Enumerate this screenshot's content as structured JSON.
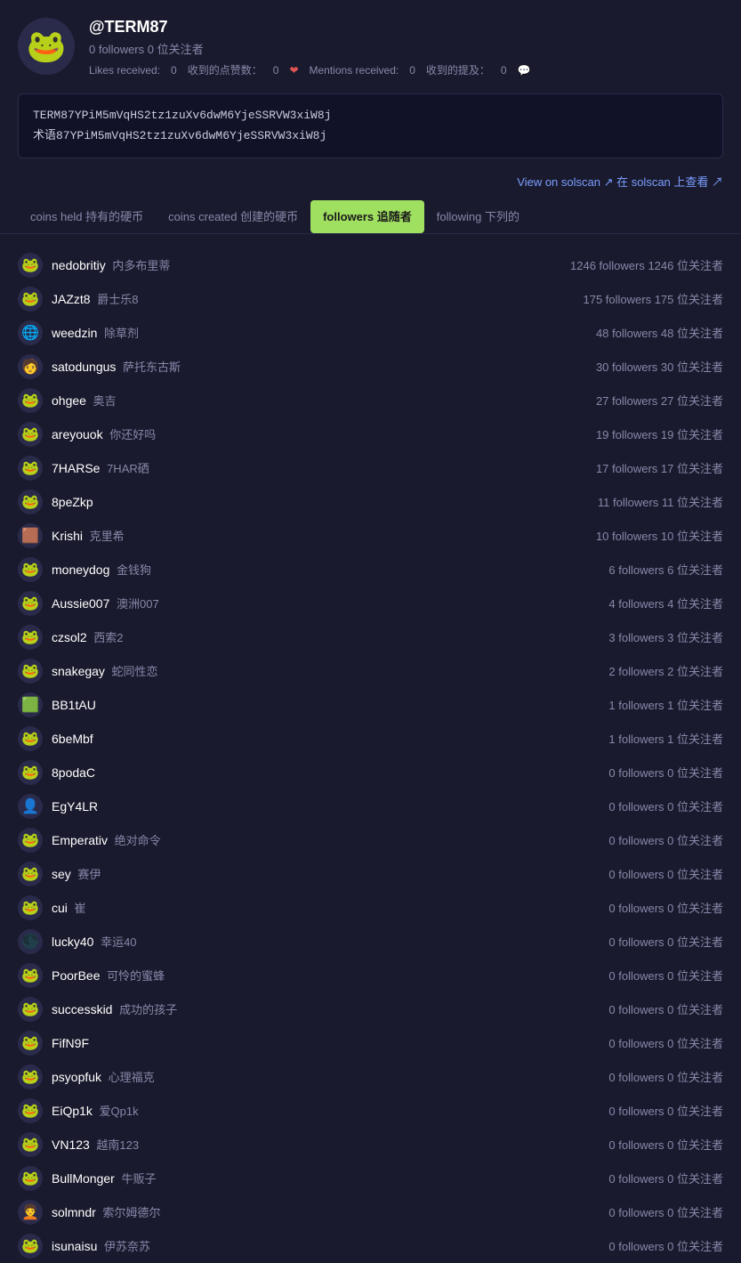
{
  "profile": {
    "username": "@TERM87",
    "stats": "0 followers 0 位关注者",
    "likes_label": "Likes received:",
    "likes_value": "0",
    "likes_chinese": "收到的点赞数：",
    "likes_count": "0",
    "heart": "❤",
    "mentions_label": "Mentions received:",
    "mentions_value": "0",
    "mentions_chinese": "收到的提及：",
    "mentions_count": "0",
    "wallet1": "TERM87YPiM5mVqHS2tz1zuXv6dwM6YjeSSRVW3xiW8j",
    "wallet2": "术语87YPiM5mVqHS2tz1zuXv6dwM6YjeSSRVW3xiW8j",
    "view_solscan": "View on solscan ↗ 在 solscan 上查看 ↗"
  },
  "tabs": [
    {
      "id": "coins-held",
      "label": "coins held 持有的硬币",
      "active": false
    },
    {
      "id": "coins-created",
      "label": "coins created 创建的硬币",
      "active": false
    },
    {
      "id": "followers",
      "label": "followers 追随者",
      "active": true
    },
    {
      "id": "following",
      "label": "following 下列的",
      "active": false
    }
  ],
  "followers": [
    {
      "name": "nedobritiy",
      "chinese": "内多布里蒂",
      "count": "1246 followers 1246 位关注者",
      "emoji": "🐸"
    },
    {
      "name": "JAZzt8",
      "chinese": "爵士乐8",
      "count": "175 followers 175 位关注者",
      "emoji": "🐸"
    },
    {
      "name": "weedzin",
      "chinese": "除草剂",
      "count": "48 followers 48 位关注者",
      "emoji": "🌐"
    },
    {
      "name": "satodungus",
      "chinese": "萨托东古斯",
      "count": "30 followers 30 位关注者",
      "emoji": "🧑"
    },
    {
      "name": "ohgee",
      "chinese": "奥吉",
      "count": "27 followers 27 位关注者",
      "emoji": "🐸"
    },
    {
      "name": "areyouok",
      "chinese": "你还好吗",
      "count": "19 followers 19 位关注者",
      "emoji": "🐸"
    },
    {
      "name": "7HARSe",
      "chinese": "7HAR硒",
      "count": "17 followers 17 位关注者",
      "emoji": "🐸"
    },
    {
      "name": "8peZkp",
      "chinese": "",
      "count": "11 followers 11 位关注者",
      "emoji": "🐸"
    },
    {
      "name": "Krishi",
      "chinese": "克里希",
      "count": "10 followers 10 位关注者",
      "emoji": "🟫"
    },
    {
      "name": "moneydog",
      "chinese": "金钱狗",
      "count": "6 followers 6 位关注者",
      "emoji": "🐸"
    },
    {
      "name": "Aussie007",
      "chinese": "澳洲007",
      "count": "4 followers 4 位关注者",
      "emoji": "🐸"
    },
    {
      "name": "czsol2",
      "chinese": "西索2",
      "count": "3 followers 3 位关注者",
      "emoji": "🐸"
    },
    {
      "name": "snakegay",
      "chinese": "蛇同性恋",
      "count": "2 followers 2 位关注者",
      "emoji": "🐸"
    },
    {
      "name": "BB1tAU",
      "chinese": "",
      "count": "1 followers 1 位关注者",
      "emoji": "🟩"
    },
    {
      "name": "6beMbf",
      "chinese": "",
      "count": "1 followers 1 位关注者",
      "emoji": "🐸"
    },
    {
      "name": "8podaC",
      "chinese": "",
      "count": "0 followers 0 位关注者",
      "emoji": "🐸"
    },
    {
      "name": "EgY4LR",
      "chinese": "",
      "count": "0 followers 0 位关注者",
      "emoji": "👤"
    },
    {
      "name": "Emperativ",
      "chinese": "绝对命令",
      "count": "0 followers 0 位关注者",
      "emoji": "🐸"
    },
    {
      "name": "sey",
      "chinese": "赛伊",
      "count": "0 followers 0 位关注者",
      "emoji": "🐸"
    },
    {
      "name": "cui",
      "chinese": "崔",
      "count": "0 followers 0 位关注者",
      "emoji": "🐸"
    },
    {
      "name": "lucky40",
      "chinese": "幸运40",
      "count": "0 followers 0 位关注者",
      "emoji": "🌑"
    },
    {
      "name": "PoorBee",
      "chinese": "可怜的蜜蜂",
      "count": "0 followers 0 位关注者",
      "emoji": "🐸"
    },
    {
      "name": "successkid",
      "chinese": "成功的孩子",
      "count": "0 followers 0 位关注者",
      "emoji": "🐸"
    },
    {
      "name": "FifN9F",
      "chinese": "",
      "count": "0 followers 0 位关注者",
      "emoji": "🐸"
    },
    {
      "name": "psyopfuk",
      "chinese": "心理福克",
      "count": "0 followers 0 位关注者",
      "emoji": "🐸"
    },
    {
      "name": "EiQp1k",
      "chinese": "爱Qp1k",
      "count": "0 followers 0 位关注者",
      "emoji": "🐸"
    },
    {
      "name": "VN123",
      "chinese": "越南123",
      "count": "0 followers 0 位关注者",
      "emoji": "🐸"
    },
    {
      "name": "BullMonger",
      "chinese": "牛贩子",
      "count": "0 followers 0 位关注者",
      "emoji": "🐸"
    },
    {
      "name": "solmndr",
      "chinese": "索尔姆德尔",
      "count": "0 followers 0 位关注者",
      "emoji": "🧑‍🦱"
    },
    {
      "name": "isunaisu",
      "chinese": "伊苏奈苏",
      "count": "0 followers 0 位关注者",
      "emoji": "🐸"
    }
  ]
}
